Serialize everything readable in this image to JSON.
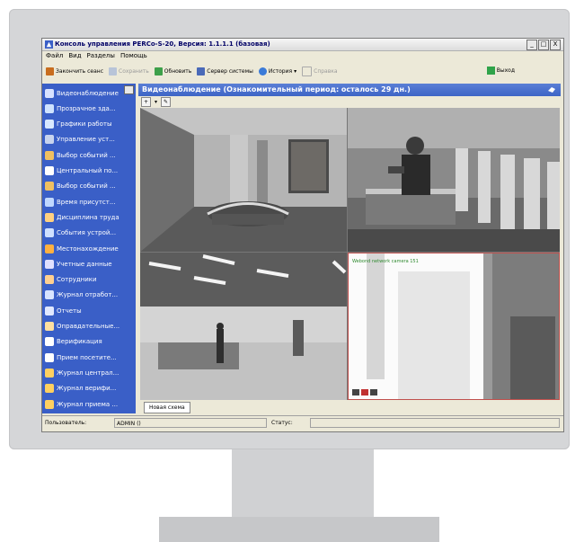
{
  "window": {
    "title": "Консоль управления PERCo-S-20, Версия: 1.1.1.1 (базовая)",
    "controls": [
      "_",
      "□",
      "X"
    ]
  },
  "menu": [
    "Файл",
    "Вид",
    "Разделы",
    "Помощь"
  ],
  "toolbar": {
    "end_session": "Закончить сеанс",
    "save": "Сохранить",
    "refresh": "Обновить",
    "server": "Сервер системы",
    "history": "История",
    "help": "Справка",
    "exit": "Выход"
  },
  "sidebar": [
    {
      "label": "Видеонаблюдение",
      "icon": "camera-icon",
      "color": "#d8e2ff"
    },
    {
      "label": "Прозрачное зда...",
      "icon": "building-icon",
      "color": "#cfe3ff"
    },
    {
      "label": "Графики работы",
      "icon": "calendar-icon",
      "color": "#d8e8ff"
    },
    {
      "label": "Управление уст...",
      "icon": "device-icon",
      "color": "#c8d4ee"
    },
    {
      "label": "Выбор событий ...",
      "icon": "events-icon",
      "color": "#f0c060"
    },
    {
      "label": "Центральный по...",
      "icon": "monitor-icon",
      "color": "#ffffff"
    },
    {
      "label": "Выбор событий ...",
      "icon": "events-icon",
      "color": "#f0c060"
    },
    {
      "label": "Время присутст...",
      "icon": "clock-icon",
      "color": "#c0d8ff"
    },
    {
      "label": "Дисциплина труда",
      "icon": "discipline-icon",
      "color": "#ffd080"
    },
    {
      "label": "События устрой...",
      "icon": "device-events-icon",
      "color": "#d0e0ff"
    },
    {
      "label": "Местонахождение",
      "icon": "location-icon",
      "color": "#ffb040"
    },
    {
      "label": "Учетные данные",
      "icon": "credentials-icon",
      "color": "#e0e0ff"
    },
    {
      "label": "Сотрудники",
      "icon": "employees-icon",
      "color": "#ffd090"
    },
    {
      "label": "Журнал отработ...",
      "icon": "journal-icon",
      "color": "#d8e4ff"
    },
    {
      "label": "Отчеты",
      "icon": "reports-icon",
      "color": "#e0e8ff"
    },
    {
      "label": "Оправдательные...",
      "icon": "documents-icon",
      "color": "#ffe0a0"
    },
    {
      "label": "Верификация",
      "icon": "verify-icon",
      "color": "#ffffff"
    },
    {
      "label": "Прием посетите...",
      "icon": "visitors-icon",
      "color": "#ffffff"
    },
    {
      "label": "Журнал централ...",
      "icon": "journal-icon",
      "color": "#ffd060"
    },
    {
      "label": "Журнал верифи...",
      "icon": "journal-icon",
      "color": "#ffd060"
    },
    {
      "label": "Журнал приема ...",
      "icon": "journal-icon",
      "color": "#ffd060"
    }
  ],
  "content": {
    "header": "Видеонаблюдение (Ознакомительный период: осталось 29 дн.)",
    "camera_label": "Webond network camera 151",
    "scene_tab": "Новая схема"
  },
  "status": {
    "user_label": "Пользователь:",
    "user_value": "ADMIN ()",
    "status_label": "Статус:",
    "status_value": ""
  }
}
